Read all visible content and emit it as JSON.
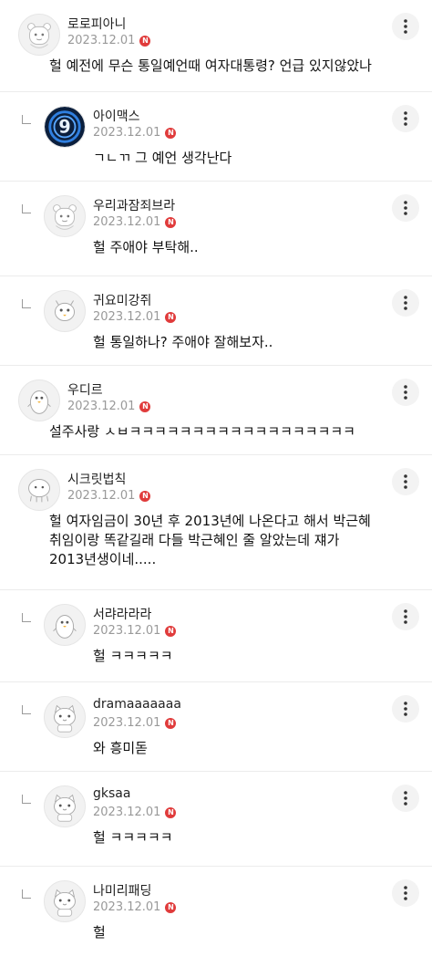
{
  "comments": [
    {
      "nickname": "로로피아니",
      "date": "2023.12.01",
      "badge": "N",
      "reply": false,
      "avatar": "bear",
      "lines": [
        "헐 예전에 무슨 통일예언때 여자대통령? 언급 있지않았나"
      ]
    },
    {
      "nickname": "아이맥스",
      "date": "2023.12.01",
      "badge": "N",
      "reply": true,
      "avatar": "nine",
      "lines": [
        "ㄱㄴㄲ 그 예언 생각난다"
      ]
    },
    {
      "nickname": "우리과잠죄브라",
      "date": "2023.12.01",
      "badge": "N",
      "reply": true,
      "avatar": "bear",
      "lines": [
        "헐 주애야 부탁해.."
      ]
    },
    {
      "nickname": "귀요미강쥐",
      "date": "2023.12.01",
      "badge": "N",
      "reply": true,
      "avatar": "chick",
      "lines": [
        "헐 통일하나? 주애야 잘해보자.."
      ]
    },
    {
      "nickname": "우디르",
      "date": "2023.12.01",
      "badge": "N",
      "reply": false,
      "avatar": "penguin",
      "lines": [
        "설주사랑 ㅅㅂㅋㅋㅋㅋㅋㅋㅋㅋㅋㅋㅋㅋㅋㅋㅋㅋㅋㅋ"
      ]
    },
    {
      "nickname": "시크릿법칙",
      "date": "2023.12.01",
      "badge": "N",
      "reply": false,
      "avatar": "blob",
      "lines": [
        "헐 여자임금이 30년 후 2013년에 나온다고 해서 박근혜",
        "취임이랑 똑같길래 다들 박근혜인 줄 알았는데 쟤가",
        "2013년생이네....."
      ]
    },
    {
      "nickname": "서랴라라라",
      "date": "2023.12.01",
      "badge": "N",
      "reply": true,
      "avatar": "penguin",
      "lines": [
        "헐 ㅋㅋㅋㅋㅋ"
      ]
    },
    {
      "nickname": "dramaaaaaaa",
      "date": "2023.12.01",
      "badge": "N",
      "reply": true,
      "avatar": "cat",
      "lines": [
        "와 흥미돋"
      ]
    },
    {
      "nickname": "gksaa",
      "date": "2023.12.01",
      "badge": "N",
      "reply": true,
      "avatar": "cat",
      "lines": [
        "헐 ㅋㅋㅋㅋㅋ"
      ]
    },
    {
      "nickname": "나미리패딩",
      "date": "2023.12.01",
      "badge": "N",
      "reply": true,
      "avatar": "cat",
      "lines": [
        "헐"
      ]
    }
  ],
  "icons": {
    "more": "more-vertical-icon",
    "reply": "reply-arrow-icon",
    "new": "new-badge-icon"
  },
  "colors": {
    "badge": "#e03b3b",
    "date": "#999999",
    "divider": "#ececec"
  }
}
